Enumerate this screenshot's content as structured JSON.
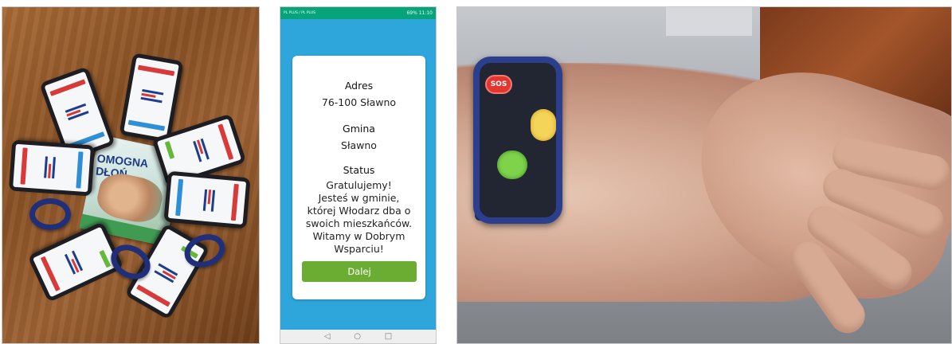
{
  "phone_screen": {
    "status_bar": {
      "carrier": "PL PLUS / PL PLUS",
      "indicators": "69% 11:10"
    },
    "card": {
      "address_label": "Adres",
      "address_value": "76-100 Sławno",
      "gmina_label": "Gmina",
      "gmina_value": "Sławno",
      "status_label": "Status",
      "status_lines": [
        "Gratulujemy!",
        "Jesteś w gminie,",
        "której Włodarz dba o",
        "swoich mieszkańców.",
        "Witamy w Dobrym",
        "Wsparciu!"
      ],
      "next_button": "Dalej"
    },
    "nav": {
      "back": "◁",
      "home": "○",
      "recents": "□"
    },
    "colors": {
      "background": "#2ea6dc",
      "status_bar": "#07a47c",
      "button": "#6aad32"
    }
  },
  "photo_left": {
    "booklet_title": "OMOGNA DŁOŃ"
  },
  "photo_right": {
    "watch_button_label": "SOS"
  }
}
